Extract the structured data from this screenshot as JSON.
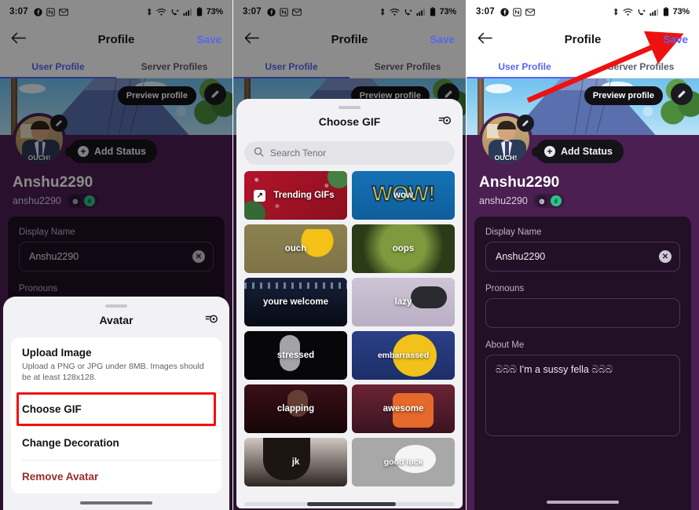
{
  "status_bar": {
    "time": "3:07",
    "battery": "73%",
    "left_icons": [
      "facebook-icon",
      "notion-icon",
      "gmail-icon"
    ],
    "right_icons": [
      "bluetooth-icon",
      "wifi-icon",
      "call-forward-icon",
      "signal-icon",
      "battery-icon"
    ]
  },
  "app_bar": {
    "back_label": "←",
    "title": "Profile",
    "save_label": "Save"
  },
  "tabs": {
    "user_profile": "User Profile",
    "server_profiles": "Server Profiles"
  },
  "profile": {
    "preview_pill": "Preview profile",
    "edit_icon_label": "✎",
    "avatar_caption": "OUCH!",
    "add_status": "Add Status",
    "display_name": "Anshu2290",
    "handle": "anshu2290",
    "badges": [
      "meteor-badge",
      "hash-badge"
    ],
    "fields": {
      "display_name_label": "Display Name",
      "display_name_value": "Anshu2290",
      "pronouns_label": "Pronouns",
      "pronouns_value": "",
      "about_me_label": "About Me",
      "about_me_value": "බබබ I'm a sussy fella බබබ"
    }
  },
  "avatar_sheet": {
    "title": "Avatar",
    "help_icon": "help-icon",
    "items": [
      {
        "title": "Upload Image",
        "subtitle": "Upload a PNG or JPG under 8MB. Images should be at least 128x128.",
        "danger": false
      },
      {
        "title": "Choose GIF",
        "subtitle": "",
        "danger": false
      },
      {
        "title": "Change Decoration",
        "subtitle": "",
        "danger": false
      },
      {
        "title": "Remove Avatar",
        "subtitle": "",
        "danger": true
      }
    ],
    "highlight_index": 1,
    "highlight_color": "#ee1111"
  },
  "gif_sheet": {
    "title": "Choose GIF",
    "help_icon": "help-icon",
    "search_placeholder": "Search Tenor",
    "search_value": "",
    "search_icon": "search-icon",
    "items": [
      {
        "label": "Trending GIFs",
        "style": "trend",
        "featured": true
      },
      {
        "label": "wow",
        "style": "wow"
      },
      {
        "label": "ouch",
        "style": "ouch"
      },
      {
        "label": "oops",
        "style": "oops"
      },
      {
        "label": "youre welcome",
        "style": "welcome"
      },
      {
        "label": "lazy",
        "style": "lazy"
      },
      {
        "label": "stressed",
        "style": "stressed"
      },
      {
        "label": "embarrassed",
        "style": "embar"
      },
      {
        "label": "clapping",
        "style": "clap"
      },
      {
        "label": "awesome",
        "style": "awesome"
      },
      {
        "label": "jk",
        "style": "jk"
      },
      {
        "label": "good luck",
        "style": "goodluck"
      }
    ]
  },
  "annotations": {
    "arrow_color": "#ee1111",
    "arrow_target": "Save"
  },
  "colors": {
    "accent_blurple": "#5865f2",
    "profile_purple": "#4b1f52",
    "field_card": "#221026",
    "sheet_bg": "#f2f2f5",
    "danger_red": "#9b2b2b",
    "highlight_red": "#ee1111"
  }
}
